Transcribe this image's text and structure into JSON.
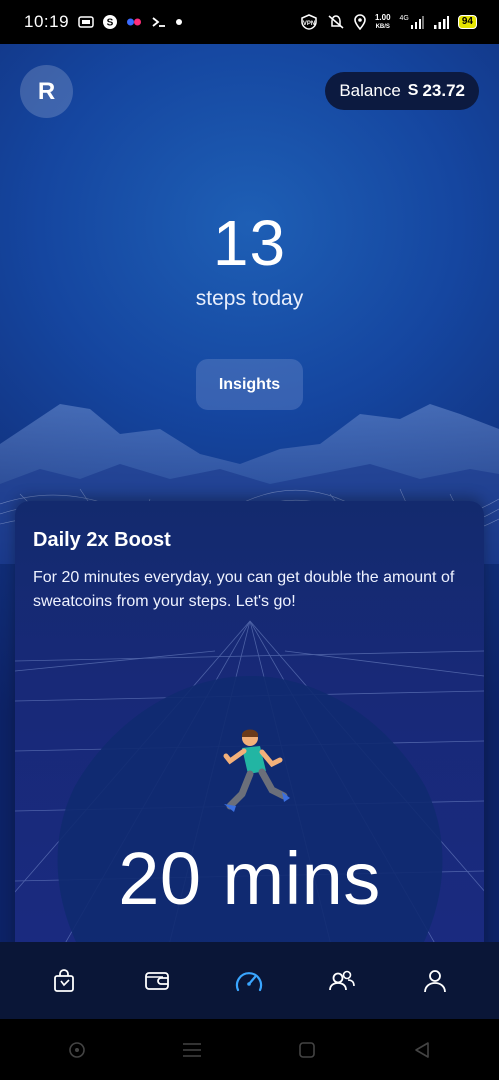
{
  "status_bar": {
    "time": "10:19",
    "speed_value": "1.00",
    "speed_unit": "KB/S",
    "network": "4G",
    "battery": "94",
    "left_icons": [
      "sim-card-icon",
      "s-app-icon",
      "flickr-icon",
      "terminal-icon",
      "dot-icon"
    ],
    "right_icons": [
      "vpn-icon",
      "mute-icon",
      "location-icon",
      "signal-icon",
      "signal-icon"
    ]
  },
  "header": {
    "avatar_initial": "R",
    "balance_label": "Balance",
    "balance_coin_symbol": "S",
    "balance_amount": "23.72"
  },
  "steps": {
    "count": "13",
    "label": "steps today"
  },
  "insights_button": "Insights",
  "boost_card": {
    "title": "Daily 2x Boost",
    "description": "For 20 minutes everyday, you can get double the amount of sweatcoins from your steps. Let's go!",
    "duration": "20 mins"
  },
  "bottom_nav": {
    "items": [
      {
        "icon": "shopping-bag-icon",
        "active": false
      },
      {
        "icon": "wallet-icon",
        "active": false
      },
      {
        "icon": "speedometer-icon",
        "active": true
      },
      {
        "icon": "friends-icon",
        "active": false
      },
      {
        "icon": "profile-icon",
        "active": false
      }
    ],
    "active_color": "#3aa6ff",
    "inactive_color": "#ffffff"
  },
  "system_nav": [
    "circle-icon",
    "menu-icon",
    "square-icon",
    "back-icon"
  ],
  "colors": {
    "background_top": "#1e5fb5",
    "background_bottom": "#0d2266",
    "balance_pill": "#0c1a40",
    "nav_bg": "#0a1637"
  }
}
